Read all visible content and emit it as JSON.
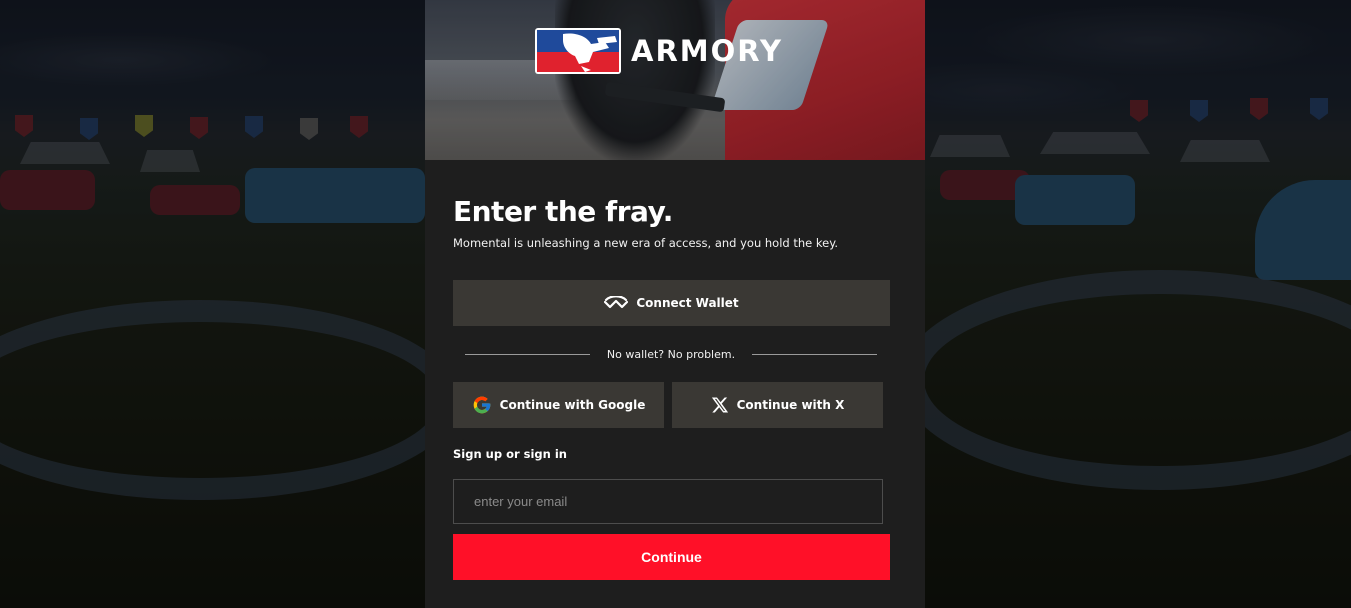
{
  "brand": {
    "name": "ARMORY",
    "logo_icon": "armory-paintball-logo-icon",
    "colors": {
      "red": "#e0222e",
      "blue": "#1f4a9b",
      "white": "#ffffff"
    }
  },
  "heading": {
    "title": "Enter the fray.",
    "subtitle": "Momental is unleashing a new era of access, and you hold the key."
  },
  "wallet": {
    "label": "Connect Wallet",
    "icon": "walletconnect-icon"
  },
  "divider": {
    "text": "No wallet? No problem."
  },
  "social": {
    "google": {
      "label": "Continue with Google",
      "icon": "google-icon"
    },
    "x": {
      "label": "Continue with X",
      "icon": "x-logo-icon"
    }
  },
  "signin": {
    "label": "Sign up or sign in",
    "email_placeholder": "enter your email",
    "email_value": "",
    "continue_label": "Continue"
  },
  "theme": {
    "panel_bg": "#1e1e1e",
    "button_bg": "#3a3834",
    "accent": "#ff1028"
  }
}
